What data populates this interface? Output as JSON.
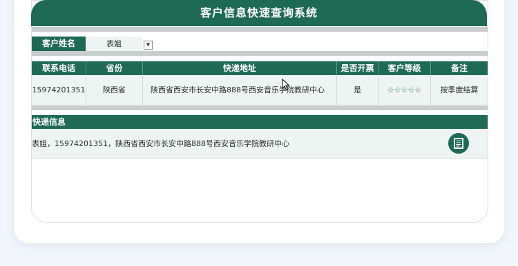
{
  "title": "客户信息快速查询系统",
  "customer_name": {
    "label": "客户姓名",
    "value": "表姐"
  },
  "table": {
    "headers": [
      "联系电话",
      "省份",
      "快递地址",
      "是否开票",
      "客户等级",
      "备注"
    ],
    "row": {
      "phone": "15974201351",
      "province": "陕西省",
      "address": "陕西省西安市长安中路888号西安音乐学院教研中心",
      "invoice": "是",
      "level": "☆☆☆☆☆",
      "note": "按季度结算"
    }
  },
  "express": {
    "header": "快递信息",
    "text": "表姐，15974201351，陕西省西安市长安中路888号西安音乐学院教研中心"
  },
  "colors": {
    "accent": "#1e6a55",
    "row_bg": "#eef4f2",
    "separator": "#c9cdcc",
    "page_bg": "#f2f6fa"
  },
  "icons": {
    "dropdown": "chevron-down-icon",
    "copy": "copy-document-icon",
    "cursor": "mouse-cursor-icon"
  }
}
